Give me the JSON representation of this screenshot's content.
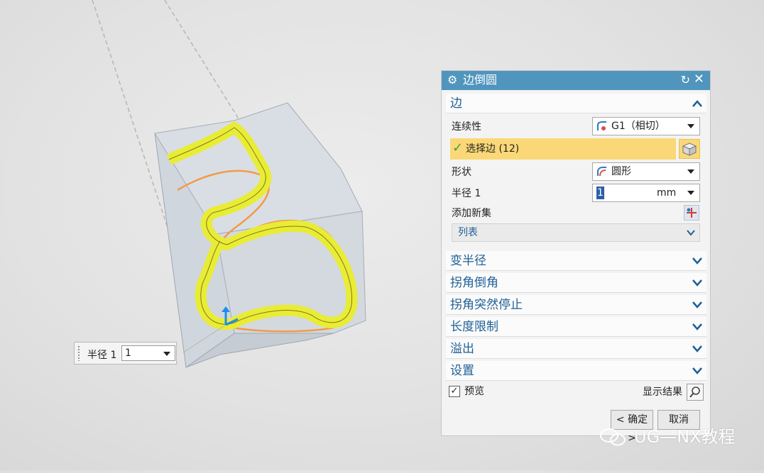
{
  "floating_input": {
    "label": "半径 1",
    "value": "1"
  },
  "dialog": {
    "title": "边倒圆",
    "sections": {
      "edge": {
        "title": "边",
        "continuity_label": "连续性",
        "continuity_value": "G1（相切）",
        "select_edge": "选择边 (12)",
        "shape_label": "形状",
        "shape_value": "圆形",
        "radius_label": "半径 1",
        "radius_value": "1",
        "radius_unit": "mm",
        "add_set_label": "添加新集",
        "list_label": "列表"
      },
      "collapsed": [
        "变半径",
        "拐角倒角",
        "拐角突然停止",
        "长度限制",
        "溢出",
        "设置"
      ]
    },
    "preview_label": "预览",
    "show_result_label": "显示结果",
    "ok_label": "< 确定 >",
    "cancel_label": "取消",
    "accent_color": "#4f95bd",
    "highlight_color": "#fbd877"
  },
  "watermark": "UG—NX教程"
}
